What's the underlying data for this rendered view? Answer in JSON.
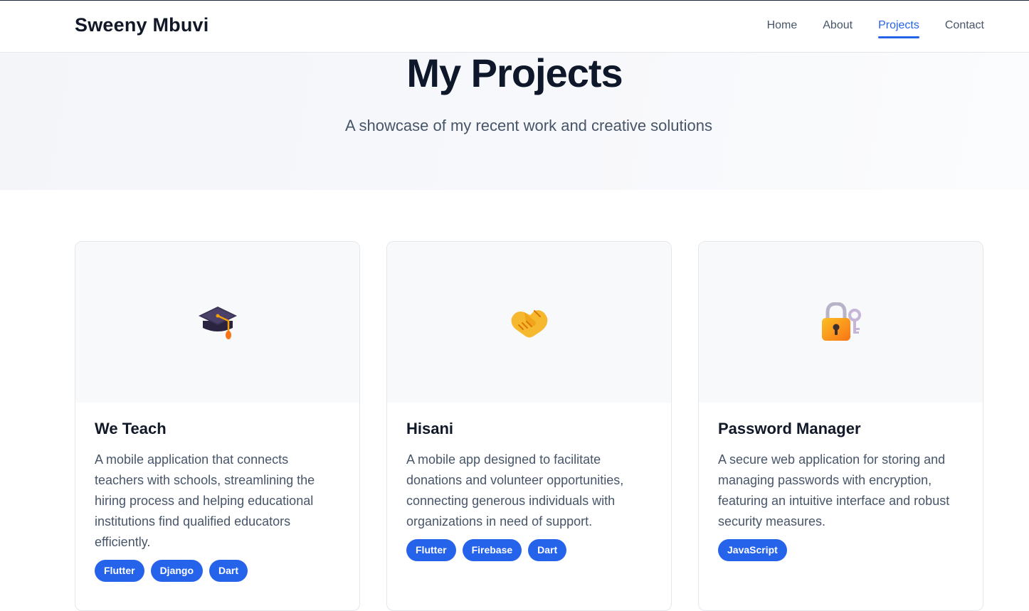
{
  "header": {
    "brand": "Sweeny Mbuvi",
    "nav": [
      {
        "label": "Home",
        "active": false
      },
      {
        "label": "About",
        "active": false
      },
      {
        "label": "Projects",
        "active": true
      },
      {
        "label": "Contact",
        "active": false
      }
    ]
  },
  "hero": {
    "title": "My Projects",
    "subtitle": "A showcase of my recent work and creative solutions"
  },
  "projects": [
    {
      "icon": "graduation-cap-icon",
      "title": "We Teach",
      "description": "A mobile application that connects teachers with schools, streamlining the hiring process and helping educational institutions find qualified educators efficiently.",
      "tags": [
        "Flutter",
        "Django",
        "Dart"
      ]
    },
    {
      "icon": "handshake-icon",
      "title": "Hisani",
      "description": "A mobile app designed to facilitate donations and volunteer opportunities, connecting generous individuals with organizations in need of support.",
      "tags": [
        "Flutter",
        "Firebase",
        "Dart"
      ]
    },
    {
      "icon": "lock-with-key-icon",
      "title": "Password Manager",
      "description": "A secure web application for storing and managing passwords with encryption, featuring an intuitive interface and robust security measures.",
      "tags": [
        "JavaScript"
      ]
    }
  ],
  "colors": {
    "accent": "#2563eb",
    "heading": "#0f172a",
    "body_text": "#475569"
  }
}
